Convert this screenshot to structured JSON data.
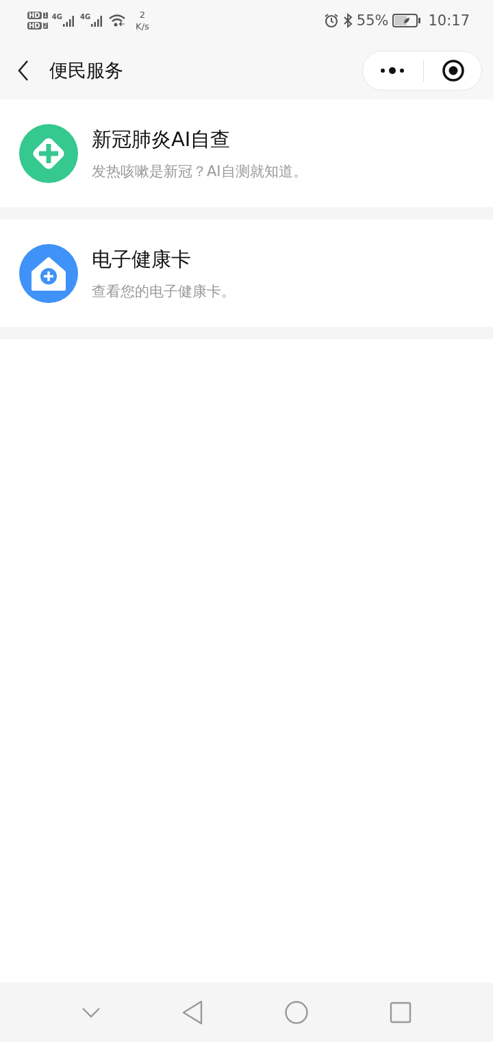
{
  "status_bar": {
    "sims": [
      {
        "label": "HD",
        "slot": "1"
      },
      {
        "label": "HD",
        "slot": "2"
      }
    ],
    "networks": [
      "4G",
      "4G"
    ],
    "speed": {
      "value": "2",
      "unit": "K/s"
    },
    "battery": "55%",
    "time": "10:17"
  },
  "header": {
    "title": "便民服务"
  },
  "services": [
    {
      "kind": "diamond-cross",
      "color": "#35c88f",
      "title": "新冠肺炎AI自查",
      "subtitle": "发热咳嗽是新冠？AI自测就知道。"
    },
    {
      "kind": "house-cross",
      "color": "#3f92f7",
      "title": "电子健康卡",
      "subtitle": "查看您的电子健康卡。"
    }
  ]
}
